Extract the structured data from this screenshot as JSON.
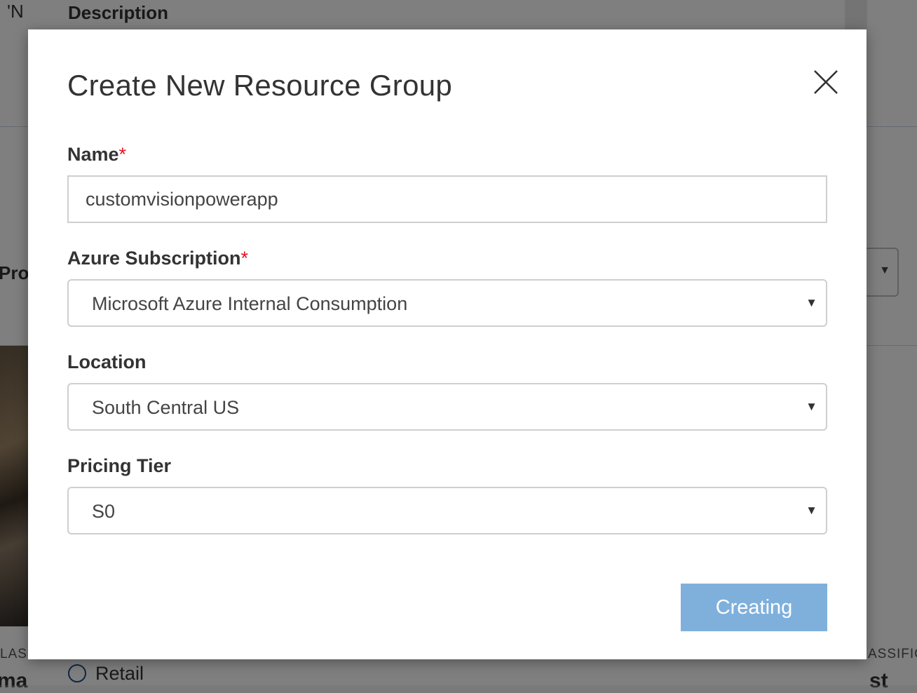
{
  "background": {
    "fragment_top_left": "'N",
    "description_heading": "Description",
    "fragment_proj": "Proj",
    "fragment_class_left": "LASS",
    "fragment_bottom_left": "ma",
    "fragment_class_right": "ASSIFIC",
    "fragment_bottom_right": "st",
    "radio_label": "Retail"
  },
  "dialog": {
    "title": "Create New Resource Group",
    "close_icon": "close-icon",
    "name": {
      "label": "Name",
      "required_mark": "*",
      "value": "customvisionpowerapp"
    },
    "subscription": {
      "label": "Azure Subscription",
      "required_mark": "*",
      "selected": "Microsoft Azure Internal Consumption"
    },
    "location": {
      "label": "Location",
      "selected": "South Central US"
    },
    "pricing_tier": {
      "label": "Pricing Tier",
      "selected": "S0"
    },
    "submit_label": "Creating",
    "caret_glyph": "▼"
  },
  "colors": {
    "required": "#e81123",
    "button": "#7fb0dc",
    "overlay": "rgba(0,0,0,0.5)"
  }
}
